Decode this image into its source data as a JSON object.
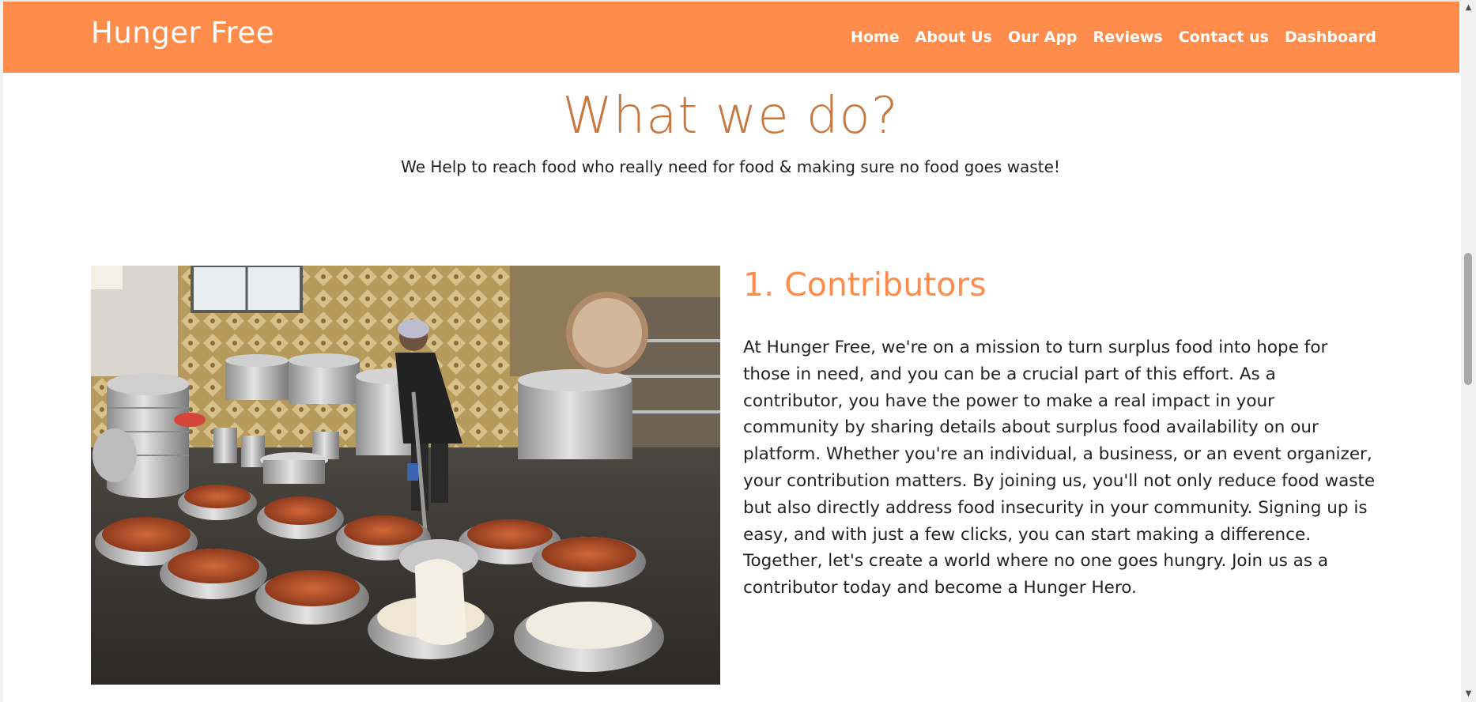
{
  "header": {
    "brand": "Hunger Free",
    "nav": [
      "Home",
      "About Us",
      "Our App",
      "Reviews",
      "Contact us",
      "Dashboard"
    ]
  },
  "section": {
    "title": "What we do?",
    "subtitle": "We Help to reach food who really need for food & making sure no food goes waste!"
  },
  "feature": {
    "title": "1. Contributors",
    "description": "At Hunger Free, we're on a mission to turn surplus food into hope for those in need, and you can be a crucial part of this effort. As a contributor, you have the power to make a real impact in your community by sharing details about surplus food availability on our platform. Whether you're an individual, a business, or an event organizer, your contribution matters. By joining us, you'll not only reduce food waste but also directly address food insecurity in your community. Signing up is easy, and with just a few clicks, you can start making a difference. Together, let's create a world where no one goes hungry. Join us as a contributor today and become a Hunger Hero.",
    "image_icon": "kitchen-photo"
  },
  "colors": {
    "navbar": "#ff8c4a",
    "heading": "#c8783f",
    "feature_title": "#ff8c4a"
  }
}
